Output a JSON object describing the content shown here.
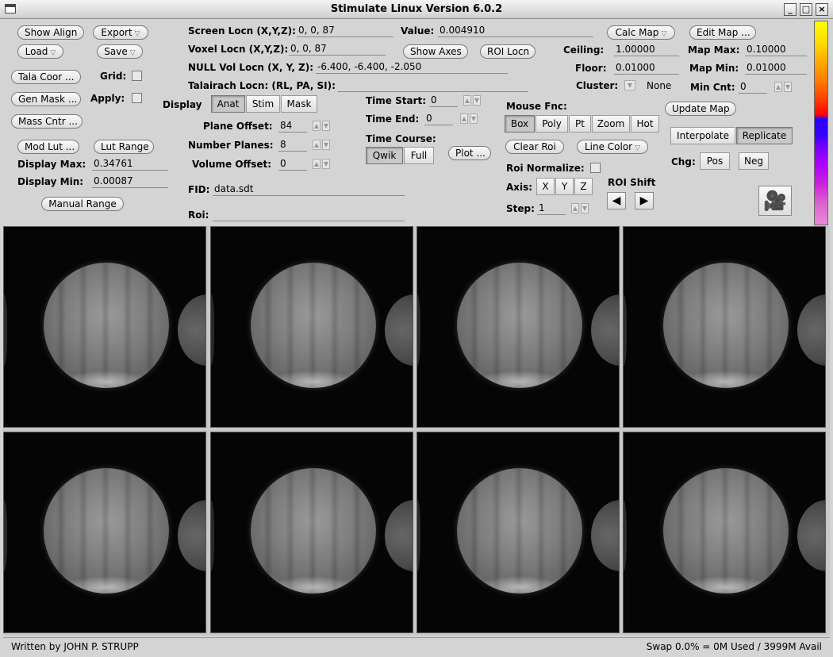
{
  "window": {
    "title": "Stimulate Linux Version 6.0.2",
    "minimize_glyph": "_",
    "maximize_glyph": "□",
    "close_glyph": "×"
  },
  "left_buttons": {
    "show_align": "Show Align",
    "export": "Export",
    "load": "Load",
    "save": "Save",
    "tala_coor": "Tala Coor ...",
    "gen_mask": "Gen Mask ...",
    "mass_cntr": "Mass Cntr ...",
    "mod_lut": "Mod Lut ...",
    "lut_range": "Lut Range",
    "manual_range": "Manual Range",
    "dropdown_glyph": "▽"
  },
  "left_labels": {
    "grid": "Grid:",
    "apply": "Apply:",
    "display_max": "Display Max:",
    "display_min": "Display Min:"
  },
  "left_values": {
    "display_max": "0.34761",
    "display_min": "0.00087"
  },
  "locations": {
    "screen_locn_label": "Screen Locn (X,Y,Z):",
    "screen_locn": "0, 0, 87",
    "value_label": "Value:",
    "value": "0.004910",
    "voxel_locn_label": "Voxel Locn (X,Y,Z):",
    "voxel_locn": "0, 0, 87",
    "show_axes": "Show Axes",
    "roi_locn": "ROI Locn",
    "null_vol_label": "NULL Vol Locn (X, Y, Z):",
    "null_vol": "-6.400, -6.400, -2.050",
    "talairach_label": "Talairach Locn: (RL, PA, SI):",
    "talairach": ""
  },
  "display": {
    "label": "Display",
    "modes": [
      "Anat",
      "Stim",
      "Mask"
    ],
    "selected": "Anat",
    "plane_offset_label": "Plane Offset:",
    "plane_offset": "84",
    "number_planes_label": "Number Planes:",
    "number_planes": "8",
    "volume_offset_label": "Volume Offset:",
    "volume_offset": "0",
    "spin_up": "▲",
    "spin_down": "▼"
  },
  "time": {
    "start_label": "Time Start:",
    "start": "0",
    "end_label": "Time End:",
    "end": "0",
    "course_label": "Time Course:",
    "course_modes": [
      "Qwik",
      "Full"
    ],
    "course_selected": "Qwik",
    "plot": "Plot ..."
  },
  "files": {
    "fid_label": "FID:",
    "fid": "data.sdt",
    "roi_label": "Roi:",
    "roi": ""
  },
  "mouse": {
    "label": "Mouse Fnc:",
    "modes": [
      "Box",
      "Poly",
      "Pt",
      "Zoom",
      "Hot"
    ],
    "selected": "Box",
    "clear_roi": "Clear Roi",
    "line_color": "Line Color",
    "roi_normalize_label": "Roi Normalize:",
    "axis_label": "Axis:",
    "axes": [
      "X",
      "Y",
      "Z"
    ],
    "roi_shift_label": "ROI Shift",
    "step_label": "Step:",
    "step": "1",
    "left_arrow": "◀",
    "right_arrow": "▶"
  },
  "map": {
    "calc_map": "Calc Map",
    "edit_map": "Edit Map ...",
    "ceiling_label": "Ceiling:",
    "ceiling": "1.00000",
    "floor_label": "Floor:",
    "floor": "0.01000",
    "cluster_label": "Cluster:",
    "cluster_value": "None",
    "map_max_label": "Map Max:",
    "map_max": "0.10000",
    "map_min_label": "Map Min:",
    "map_min": "0.01000",
    "min_cnt_label": "Min Cnt:",
    "min_cnt": "0",
    "update_map": "Update Map",
    "interp_modes": [
      "Interpolate",
      "Replicate"
    ],
    "interp_selected": "Replicate",
    "chg_label": "Chg:",
    "pos": "Pos",
    "neg": "Neg",
    "movie_icon": "🎥"
  },
  "images": {
    "count": 8
  },
  "status": {
    "author": "Written by JOHN P. STRUPP",
    "swap": "Swap 0.0% = 0M Used / 3999M Avail"
  }
}
